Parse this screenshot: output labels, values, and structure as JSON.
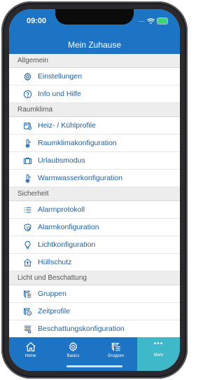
{
  "status": {
    "time": "09:00"
  },
  "nav": {
    "title": "Mein Zuhause"
  },
  "sections": [
    {
      "header": "Allgemein",
      "items": [
        {
          "label": "Einstellungen",
          "icon": "gear-icon"
        },
        {
          "label": "Info und Hilfe",
          "icon": "help-icon"
        }
      ]
    },
    {
      "header": "Raumklima",
      "items": [
        {
          "label": "Heiz- / Kühlprofile",
          "icon": "calendar-icon"
        },
        {
          "label": "Raumklimakonfiguration",
          "icon": "thermometer-icon"
        },
        {
          "label": "Urlaubsmodus",
          "icon": "suitcase-icon"
        },
        {
          "label": "Warmwasserkonfiguration",
          "icon": "thermometer-icon"
        }
      ]
    },
    {
      "header": "Sicherheit",
      "items": [
        {
          "label": "Alarmprotokoll",
          "icon": "list-icon"
        },
        {
          "label": "Alarmkonfiguration",
          "icon": "alarm-shield-icon"
        },
        {
          "label": "Lichtkonfiguration",
          "icon": "bulb-icon"
        },
        {
          "label": "Hüllschutz",
          "icon": "house-shield-icon"
        }
      ]
    },
    {
      "header": "Licht und Beschattung",
      "items": [
        {
          "label": "Gruppen",
          "icon": "groups-icon"
        },
        {
          "label": "Zeitprofile",
          "icon": "timeprofile-icon"
        },
        {
          "label": "Beschattungskonfiguration",
          "icon": "shutter-icon"
        }
      ]
    }
  ],
  "tabs": [
    {
      "label": "Home",
      "icon": "home-icon"
    },
    {
      "label": "Basics",
      "icon": "gear-icon"
    },
    {
      "label": "Gruppen",
      "icon": "groups-icon"
    },
    {
      "label": "Mehr",
      "icon": "more-icon"
    }
  ],
  "colors": {
    "primary": "#1d74c4",
    "active_tab": "#3fb8c9",
    "item_text": "#1f5f9e",
    "section_bg": "#ededed"
  }
}
